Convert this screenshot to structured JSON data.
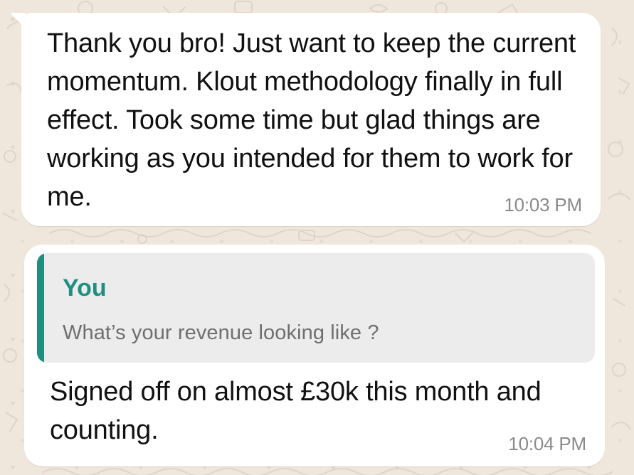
{
  "chat": {
    "messages": [
      {
        "text": "Thank you bro! Just want to keep the current momentum. Klout methodology finally in full effect. Took some time but glad things are working as you intended for them to work for me.",
        "time": "10:03 PM"
      },
      {
        "reply_to": {
          "author": "You",
          "text": "What’s your revenue looking like ?"
        },
        "text": "Signed off on almost £30k this month and counting.",
        "time": "10:04 PM"
      }
    ]
  },
  "theme": {
    "bubble_background": "#ffffff",
    "chat_background": "#efe7dc",
    "quote_accent": "#1f8f7f",
    "timestamp_color": "#8a8a8a"
  }
}
